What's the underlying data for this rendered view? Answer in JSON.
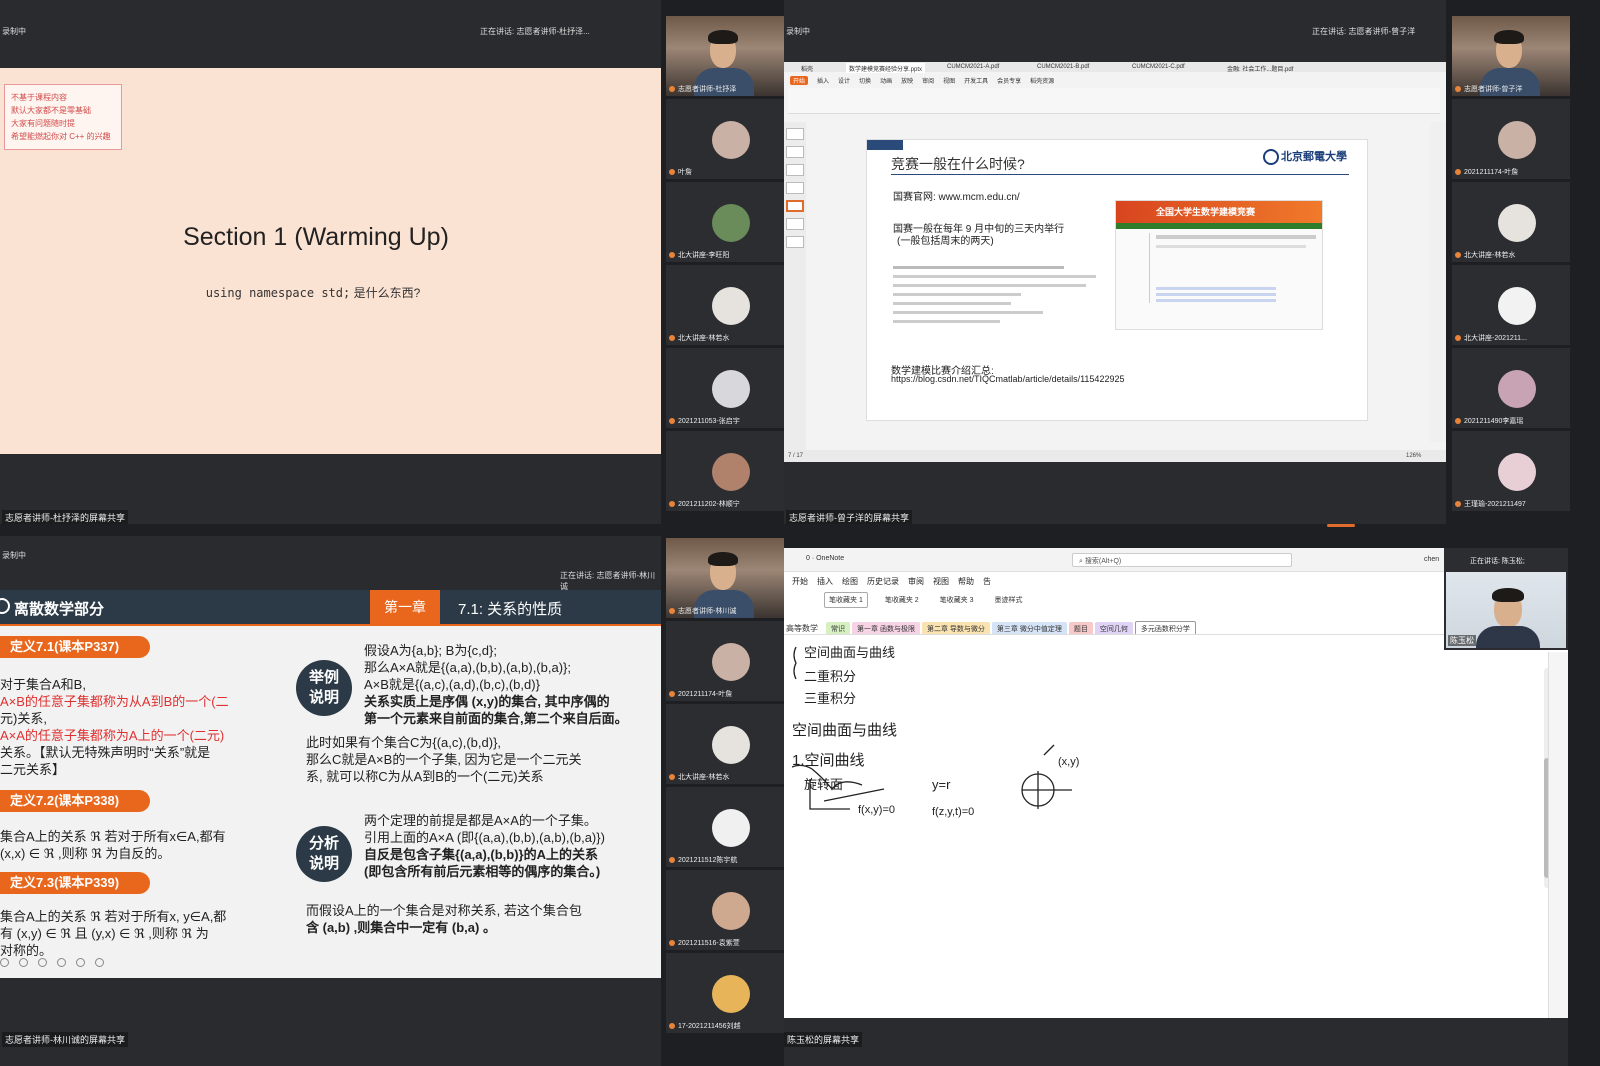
{
  "q1": {
    "recording": "录制中",
    "speaking": "正在讲话: 志愿者讲师-杜抒泽...",
    "notes": [
      "不基于课程内容",
      "默认大家都不是零基础",
      "大家有问题随时提",
      "希望能燃起你对 C++ 的兴趣"
    ],
    "title": "Section 1 (Warming Up)",
    "subtitle_code": "using namespace std;",
    "subtitle_rest": " 是什么东西?",
    "caption": "志愿者讲师-杜抒泽的屏幕共享"
  },
  "q2": {
    "recording": "录制中",
    "speaking": "正在讲话: 志愿者讲师-曾子洋",
    "tabs": [
      "稻壳",
      "数学建模竞赛经验分享.pptx",
      "CUMCM2021-A.pdf",
      "CUMCM2021-B.pdf",
      "CUMCM2021-C.pdf",
      "金融: 社会工作...题目.pdf"
    ],
    "ribbon": [
      "开始",
      "插入",
      "设计",
      "切换",
      "动画",
      "放映",
      "审阅",
      "视图",
      "开发工具",
      "会员专享",
      "稻壳资源"
    ],
    "slide_title": "竞赛一般在什么时候?",
    "logo_text": "北京郵電大學",
    "website": "国赛官网: www.mcm.edu.cn/",
    "timing_line1": "国赛一般在每年 9 月中旬的三天内举行",
    "timing_line2": "(一般包括周末的两天)",
    "banner": "全国大学生数学建模竞赛",
    "intro_label": "数学建模比赛介绍汇总:",
    "intro_url": "https://blog.csdn.net/TIQCmatlab/article/details/115422925",
    "status_left": "7 / 17",
    "status_zoom": "126%",
    "caption": "志愿者讲师-曾子洋的屏幕共享"
  },
  "q3": {
    "recording": "录制中",
    "speaking": "正在讲话: 志愿者讲师-林川诚",
    "header_title": "离散数学部分",
    "chapter": "第一章",
    "section": "7.1: 关系的性质",
    "def1_label": "定义7.1(课本P337)",
    "def1_lines": [
      "对于集合A和B,",
      "A×B的任意子集都称为从A到B的一个(二",
      "元)关系,",
      "A×A的任意子集都称为A上的一个(二元)",
      "关系。【默认无特殊声明时“关系”就是",
      "二元关系】"
    ],
    "def2_label": "定义7.2(课本P338)",
    "def2_lines": [
      "集合A上的关系 ℜ 若对于所有x∈A,都有",
      "(x,x) ∈ ℜ ,则称 ℜ 为自反的。"
    ],
    "def3_label": "定义7.3(课本P339)",
    "def3_lines": [
      "集合A上的关系 ℜ 若对于所有x, y∈A,都",
      "有 (x,y) ∈ ℜ 且 (y,x) ∈ ℜ ,则称 ℜ 为",
      "对称的。"
    ],
    "example_badge": "举例说明",
    "example_lines": [
      "假设A为{a,b}; B为{c,d};",
      "那么A×A就是{(a,a),(b,b),(a,b),(b,a)};",
      "A×B就是{(a,c),(a,d),(b,c),(b,d)}",
      "关系实质上是序偶 (x,y)的集合, 其中序偶的",
      "第一个元素来自前面的集合,第二个来自后面。",
      "此时如果有个集合C为{(a,c),(b,d)},",
      "那么C就是A×B的一个子集, 因为它是一个二元关",
      "系, 就可以称C为从A到B的一个(二元)关系"
    ],
    "analysis_badge": "分析说明",
    "analysis_lines": [
      "两个定理的前提是都是A×A的一个子集。",
      "引用上面的A×A (即{(a,a),(b,b),(a,b),(b,a)})",
      "自反是包含子集{(a,a),(b,b)}的A上的关系",
      "(即包含所有前后元素相等的偶序的集合。)"
    ],
    "sym_lines": [
      "而假设A上的一个集合是对称关系, 若这个集合包",
      "含 (a,b) ,则集合中一定有 (b,a) 。"
    ],
    "caption": "志愿者讲师-林川诚的屏幕共享"
  },
  "q4": {
    "speaking": "正在讲话: 陈玉松;",
    "app_title": "0 · OneNote",
    "search_placeholder": "搜索(Alt+Q)",
    "user": "chen",
    "menu": [
      "开始",
      "插入",
      "绘图",
      "历史记录",
      "审阅",
      "视图",
      "帮助",
      "告"
    ],
    "pens": [
      "笔收藏夹 1",
      "笔收藏夹 2",
      "笔收藏夹 3",
      "墨迹样式"
    ],
    "notebook": "高等数学",
    "sections": [
      "常识",
      "第一章 函数与极限",
      "第二章 导数与微分",
      "第三章 微分中值定理",
      "题目",
      "空间几何",
      "多元函数积分学"
    ],
    "ink": [
      "空间曲面与曲线",
      "二重积分",
      "三重积分",
      "空间曲面与曲线",
      "1.空间曲线",
      "旋转面",
      "y=r",
      "f(x,y)=0",
      "f(z,y,t)=0",
      "(x,y)"
    ],
    "presenter_name": "陈玉松",
    "caption": "陈玉松的屏幕共享"
  },
  "left_column": [
    {
      "name": "志愿者讲师-杜抒泽",
      "kind": "cam"
    },
    {
      "name": "叶詹",
      "kind": "avatar",
      "color": "#c9b1a5"
    },
    {
      "name": "北大讲座-李旺阳",
      "kind": "avatar",
      "color": "#6a8c5a"
    },
    {
      "name": "北大讲座-林若水",
      "kind": "avatar",
      "color": "#e6e3df"
    },
    {
      "name": "2021211053-张启宇",
      "kind": "avatar",
      "color": "#d8d8dc"
    },
    {
      "name": "2021211202-林顺宁",
      "kind": "avatar",
      "color": "#b0826b"
    }
  ],
  "right_column": [
    {
      "name": "志愿者讲师-曾子洋",
      "kind": "cam"
    },
    {
      "name": "2021211174-叶詹",
      "kind": "avatar",
      "color": "#c9b1a5"
    },
    {
      "name": "北大讲座-林若水",
      "kind": "avatar",
      "color": "#e6e3df"
    },
    {
      "name": "北大讲座-2021211...",
      "kind": "avatar",
      "color": "#f2f2f2"
    },
    {
      "name": "2021211490李嘉瑶",
      "kind": "avatar",
      "color": "#c7a3b3"
    },
    {
      "name": "王瑾瑜-2021211497",
      "kind": "avatar",
      "color": "#e8cfd5"
    }
  ],
  "left_column_bottom": [
    {
      "name": "志愿者讲师-林川诚",
      "kind": "cam"
    },
    {
      "name": "2021211174-叶詹",
      "kind": "avatar",
      "color": "#c9b1a5"
    },
    {
      "name": "北大讲座-林若水",
      "kind": "avatar",
      "color": "#e6e3df"
    },
    {
      "name": "2021211512陈宇航",
      "kind": "avatar",
      "color": "#f0f0f0"
    },
    {
      "name": "2021211516-袁紫萱",
      "kind": "avatar",
      "color": "#cfa890"
    },
    {
      "name": "17-2021211456刘越",
      "kind": "avatar",
      "color": "#e8b45a"
    }
  ]
}
